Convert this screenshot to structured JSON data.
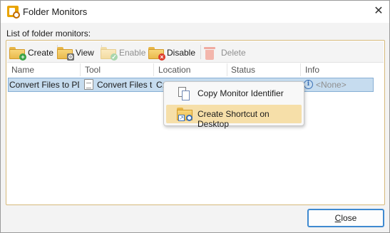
{
  "window": {
    "title": "Folder Monitors",
    "close_glyph": "✕"
  },
  "group": {
    "label": "List of folder monitors:"
  },
  "toolbar": {
    "create_label": "Create",
    "view_label": "View",
    "enable_label": "Enable",
    "disable_label": "Disable",
    "delete_label": "Delete"
  },
  "table": {
    "columns": [
      "Name",
      "Tool",
      "Location",
      "Status",
      "Info"
    ],
    "rows": [
      {
        "name": "Convert Files to PDF",
        "tool": "Convert Files to PDF",
        "location": "C:\\",
        "status": "",
        "info": "<None>"
      }
    ]
  },
  "context_menu": {
    "items": [
      {
        "label": "Copy Monitor Identifier",
        "icon": "copy-identifier-icon"
      },
      {
        "label": "Create Shortcut on Desktop",
        "icon": "desktop-shortcut-icon"
      }
    ]
  },
  "footer": {
    "close_first": "C",
    "close_rest": "lose"
  },
  "colors": {
    "selection": "#c6dcef",
    "menu_hover": "#f6dfa9",
    "accent": "#3f8ad0",
    "folder": "#e9b94c"
  }
}
